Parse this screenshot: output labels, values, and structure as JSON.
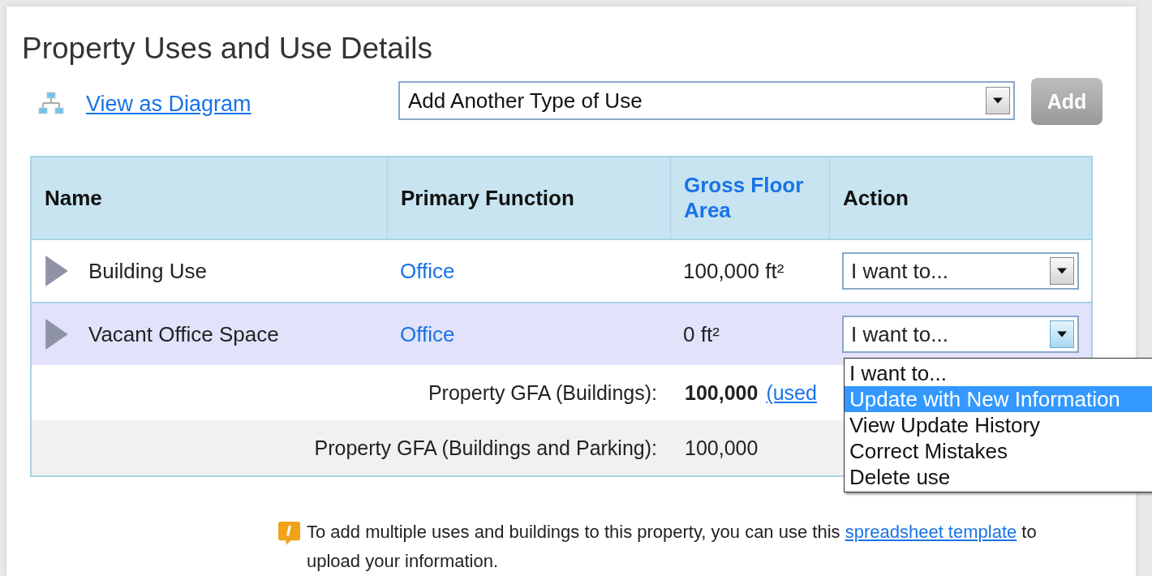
{
  "title": "Property Uses and Use Details",
  "diagram_link": "View as Diagram",
  "add_use": {
    "value": "Add Another Type of Use"
  },
  "add_button": {
    "label": "Add",
    "disabled": true
  },
  "table": {
    "columns": [
      {
        "label": "Name",
        "sortable": false
      },
      {
        "label": "Primary Function",
        "sortable": false
      },
      {
        "label": "Gross Floor Area",
        "sortable": true
      },
      {
        "label": "Action",
        "sortable": false
      }
    ],
    "rows": [
      {
        "name": "Building Use",
        "function": "Office",
        "gfa": "100,000 ft²",
        "action": "I want to...",
        "highlighted": false,
        "open": false
      },
      {
        "name": "Vacant Office Space",
        "function": "Office",
        "gfa": "0 ft²",
        "action": "I want to...",
        "highlighted": true,
        "open": true
      }
    ]
  },
  "summary": [
    {
      "label": "Property GFA (Buildings):",
      "value": "100,000",
      "bold": true,
      "link": "(used"
    },
    {
      "label": "Property GFA (Buildings and Parking):",
      "value": "100,000",
      "bold": false
    }
  ],
  "action_menu": {
    "options": [
      {
        "label": "I want to...",
        "selected": false
      },
      {
        "label": "Update with New Information",
        "selected": true
      },
      {
        "label": "View Update History",
        "selected": false
      },
      {
        "label": "Correct Mistakes",
        "selected": false
      },
      {
        "label": "Delete use",
        "selected": false
      }
    ]
  },
  "note": {
    "before": "To add multiple uses and buildings to this property, you can use this",
    "link": "spreadsheet template",
    "after": "to upload your information."
  }
}
